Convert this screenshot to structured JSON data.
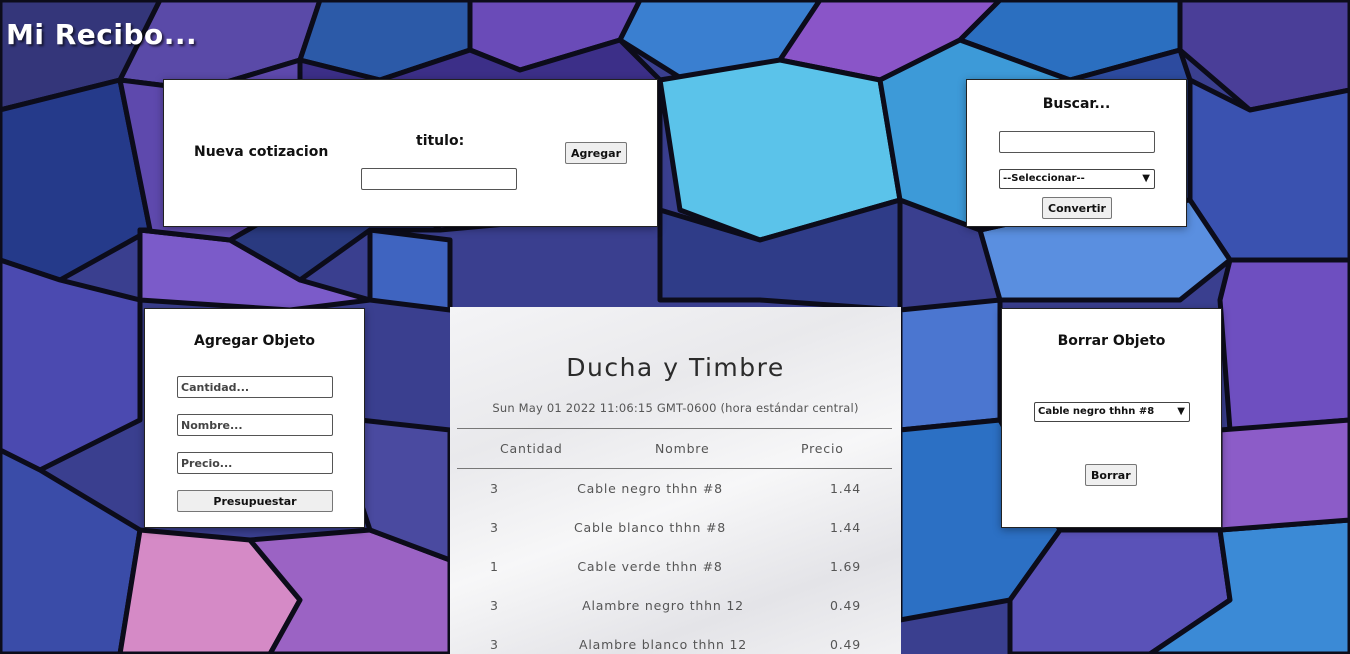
{
  "app": {
    "title": "Mi Recibo..."
  },
  "new_quote": {
    "label": "Nueva cotizacion",
    "title_label": "titulo:",
    "title_value": "",
    "add_button": "Agregar"
  },
  "search": {
    "heading": "Buscar...",
    "query_value": "",
    "select_value": "--Seleccionar--",
    "convert_button": "Convertir"
  },
  "add_item": {
    "heading": "Agregar Objeto",
    "quantity_placeholder": "Cantidad...",
    "name_placeholder": "Nombre...",
    "price_placeholder": "Precio...",
    "submit_button": "Presupuestar"
  },
  "delete_item": {
    "heading": "Borrar Objeto",
    "select_value": "Cable negro thhn #8",
    "delete_button": "Borrar"
  },
  "receipt": {
    "title": "Ducha y Timbre",
    "date": "Sun May 01 2022 11:06:15 GMT-0600 (hora estándar central)",
    "columns": [
      "Cantidad",
      "Nombre",
      "Precio"
    ],
    "rows": [
      {
        "qty": "3",
        "name": "Cable negro thhn #8",
        "price": "1.44"
      },
      {
        "qty": "3",
        "name": "Cable blanco thhn #8",
        "price": "1.44"
      },
      {
        "qty": "1",
        "name": "Cable verde thhn #8",
        "price": "1.69"
      },
      {
        "qty": "3",
        "name": "Alambre negro thhn 12",
        "price": "0.49"
      },
      {
        "qty": "3",
        "name": "Alambre blanco thhn 12",
        "price": "0.49"
      }
    ]
  },
  "colors": {
    "background_base": "#3a3f8f",
    "panel_bg": "#ffffff",
    "receipt_bg": "#f1f1f3"
  }
}
